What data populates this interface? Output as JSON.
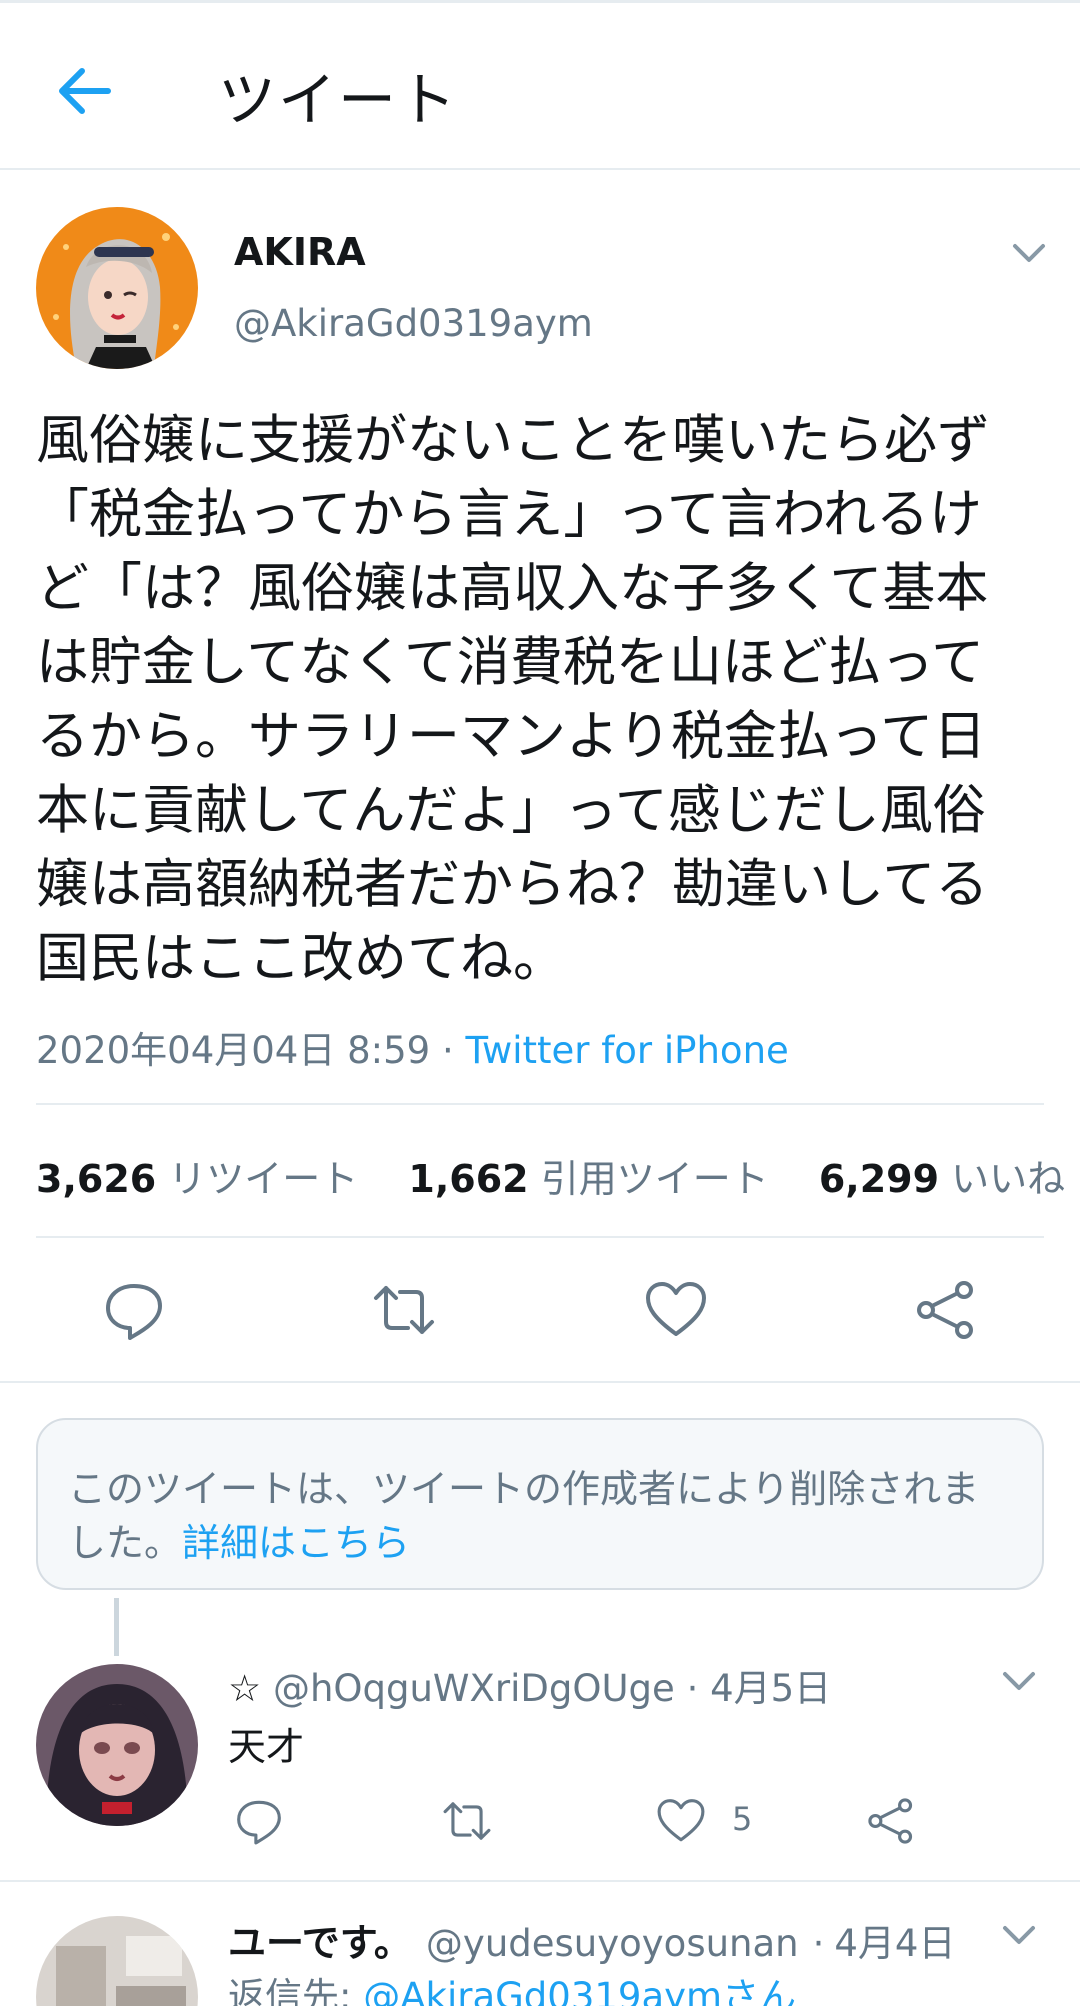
{
  "header": {
    "title": "ツイート"
  },
  "tweet": {
    "author_name": "AKIRA",
    "author_handle": "@AkiraGd0319aym",
    "lines": [
      "風俗嬢に支援がないことを嘆いたら必ず",
      "「税金払ってから言え」って言われるけ",
      "ど「は？風俗嬢は高収入な子多くて基本",
      "は貯金してなくて消費税を山ほど払って",
      "るから。サラリーマンより税金払って日",
      "本に貢献してんだよ」って感じだし風俗",
      "嬢は高額納税者だからね？勘違いしてる",
      "国民はここ改めてね。"
    ],
    "timestamp": "2020年04月04日 8:59",
    "separator": " · ",
    "source": "Twitter for iPhone"
  },
  "stats": {
    "retweets_count": "3,626",
    "retweets_label": "リツイート",
    "quotes_count": "1,662",
    "quotes_label": "引用ツイート",
    "likes_count": "6,299",
    "likes_label": "いいね"
  },
  "deleted_notice": {
    "text": "このツイートは、ツイートの作成者により削除されました。",
    "link": "詳細はこちら"
  },
  "reply1": {
    "name": "☆",
    "handle": "@hOqguWXriDgOUge",
    "date": "4月5日",
    "text": "天才",
    "like_count": "5"
  },
  "reply2": {
    "name": "ユーです。",
    "handle": "@yudesuyoyosunan",
    "date": "4月4日",
    "reply_to_prefix": "返信先: ",
    "reply_to_link": "@AkiraGd0319aymさん"
  },
  "colors": {
    "accent": "#1da1f2",
    "text": "#14171a",
    "secondary": "#657786",
    "divider": "#e6ecf0"
  }
}
